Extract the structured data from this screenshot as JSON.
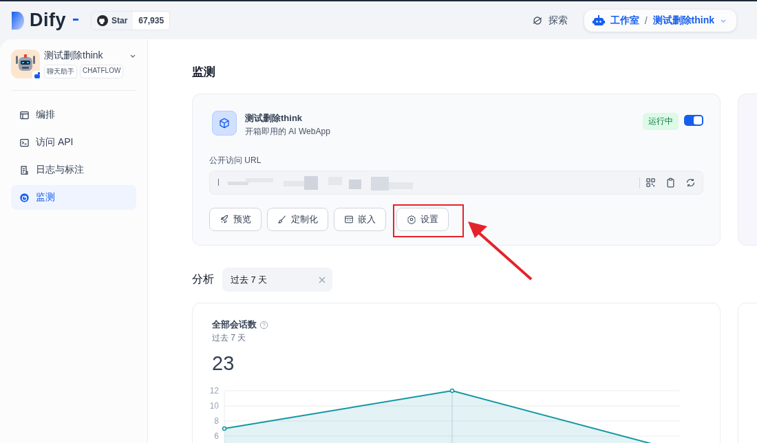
{
  "header": {
    "logo": "Dify",
    "github": {
      "label": "Star",
      "count": "67,935"
    },
    "explore": "探索",
    "breadcrumb": {
      "workspace": "工作室",
      "separator": "/",
      "app": "测试删除think"
    }
  },
  "sidebar": {
    "app": {
      "name": "测试删除think",
      "tags": [
        "聊天助手",
        "CHATFLOW"
      ]
    },
    "items": [
      {
        "label": "编排",
        "selected": false
      },
      {
        "label": "访问 API",
        "selected": false
      },
      {
        "label": "日志与标注",
        "selected": false
      },
      {
        "label": "监测",
        "selected": true
      }
    ]
  },
  "page_title": "监测",
  "overview": {
    "app_name": "测试删除think",
    "subtitle": "开箱即用的 AI WebApp",
    "status": "运行中",
    "enabled": true,
    "url_label": "公开访问 URL",
    "actions": [
      {
        "label": "预览",
        "highlighted": false
      },
      {
        "label": "定制化",
        "highlighted": false
      },
      {
        "label": "嵌入",
        "highlighted": false
      },
      {
        "label": "设置",
        "highlighted": true
      }
    ]
  },
  "analysis": {
    "label": "分析",
    "period": "过去 7 天"
  },
  "chart": {
    "title": "全部会话数",
    "subtitle": "过去 7 天",
    "total": "23",
    "chart_data": {
      "type": "area",
      "grid": true,
      "ylim": [
        0,
        12
      ],
      "yticks": [
        6,
        8,
        10,
        12
      ],
      "series": [
        {
          "color": "#1596a3",
          "values": [
            7,
            12,
            4
          ]
        }
      ]
    }
  }
}
